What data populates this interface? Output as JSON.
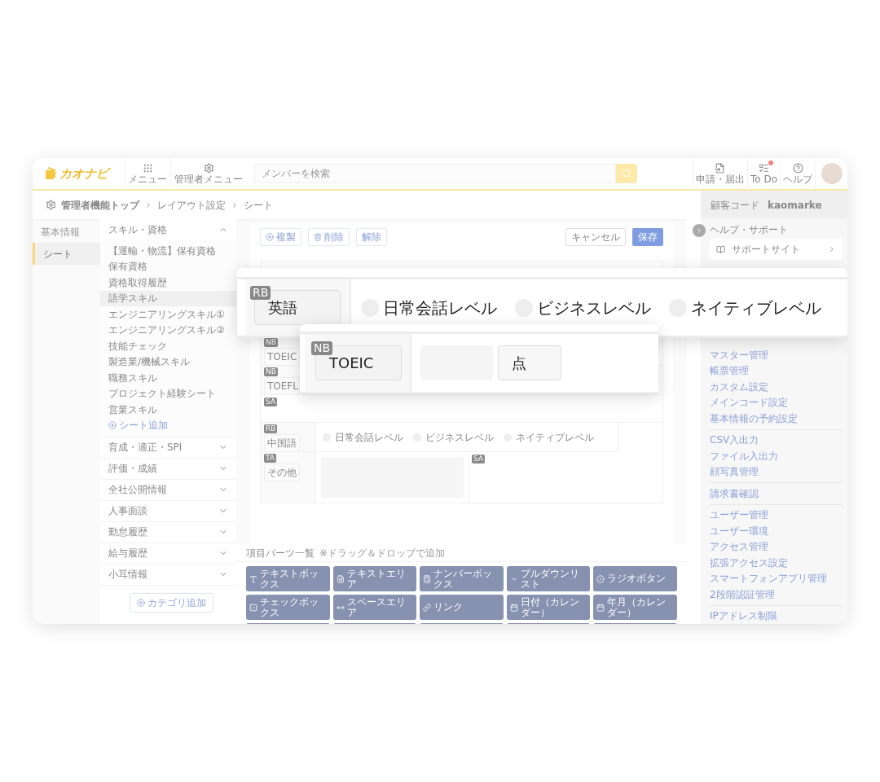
{
  "header": {
    "logo": "カオナビ",
    "nav_buttons": [
      {
        "kind": "menu",
        "label": "メニュー"
      },
      {
        "kind": "admin",
        "label": "管理者メニュー"
      }
    ],
    "search": {
      "placeholder": "メンバーを検索"
    },
    "actions": [
      {
        "kind": "request",
        "label": "申請・届出",
        "badge": false
      },
      {
        "kind": "todo",
        "label": "To Do",
        "badge": true
      },
      {
        "kind": "help",
        "label": "ヘルプ",
        "badge": false
      }
    ]
  },
  "breadcrumb": [
    "管理者機能トップ",
    "レイアウト設定",
    "シート"
  ],
  "customer_code": {
    "label": "顧客コード",
    "value": "kaomarke"
  },
  "main_nav": [
    {
      "label": "基本情報",
      "selected": false
    },
    {
      "label": "シート",
      "selected": true
    }
  ],
  "categories": [
    {
      "label": "スキル・資格",
      "expanded": true,
      "add_label": "シート追加",
      "sheets": [
        {
          "label": "【運輸・物流】保有資格",
          "selected": false
        },
        {
          "label": "保有資格",
          "selected": false
        },
        {
          "label": "資格取得履歴",
          "selected": false
        },
        {
          "label": "語学スキル",
          "selected": true
        },
        {
          "label": "エンジニアリングスキル①",
          "selected": false
        },
        {
          "label": "エンジニアリングスキル②",
          "selected": false
        },
        {
          "label": "技能チェック",
          "selected": false
        },
        {
          "label": "製造業/機械スキル",
          "selected": false
        },
        {
          "label": "職務スキル",
          "selected": false
        },
        {
          "label": "プロジェクト経験シート",
          "selected": false
        },
        {
          "label": "営業スキル",
          "selected": false
        }
      ]
    },
    {
      "label": "育成・適正・SPI",
      "expanded": false
    },
    {
      "label": "評価・成績",
      "expanded": false
    },
    {
      "label": "全社公開情報",
      "expanded": false
    },
    {
      "label": "人事面談",
      "expanded": false
    },
    {
      "label": "勤怠履歴",
      "expanded": false
    },
    {
      "label": "給与履歴",
      "expanded": false
    },
    {
      "label": "小耳情報",
      "expanded": false
    }
  ],
  "add_category": "カテゴリ追加",
  "toolbar": [
    {
      "kind": "copy",
      "label": "複製"
    },
    {
      "kind": "delete",
      "label": "削除"
    },
    {
      "kind": "plain",
      "label": "解除"
    },
    {
      "kind": "cancel",
      "label": "キャンセル"
    },
    {
      "kind": "save",
      "label": "保存"
    }
  ],
  "form_rows": [
    {
      "kind": "blank"
    },
    {
      "kind": "number",
      "tag": "NB",
      "label": "TOEIC"
    },
    {
      "kind": "number",
      "tag": "NB",
      "label": "TOEFL"
    },
    {
      "kind": "space",
      "tag": "SA"
    },
    {
      "kind": "radio",
      "tag": "RB",
      "label": "中国語",
      "options": [
        {
          "label": "日常会話レベル",
          "selected": false
        },
        {
          "label": "ビジネスレベル",
          "selected": false
        },
        {
          "label": "ネイティブレベル",
          "selected": false
        }
      ]
    },
    {
      "kind": "textarea",
      "tag": "TA",
      "label": "その他",
      "side_tag": "SA"
    }
  ],
  "parts_panel": {
    "title": "項目パーツ一覧",
    "hint": "※ドラッグ＆ドロップで追加",
    "parts": [
      {
        "kind": "textbox",
        "label": "テキストボックス"
      },
      {
        "kind": "textarea",
        "label": "テキストエリア"
      },
      {
        "kind": "number",
        "label": "ナンバーボックス"
      },
      {
        "kind": "pulldown",
        "label": "プルダウンリスト"
      },
      {
        "kind": "radio",
        "label": "ラジオボタン"
      },
      {
        "kind": "checkbox",
        "label": "チェックボックス"
      },
      {
        "kind": "space",
        "label": "スペースエリア"
      },
      {
        "kind": "link",
        "label": "リンク"
      },
      {
        "kind": "date",
        "label": "日付（カレンダー）"
      },
      {
        "kind": "month",
        "label": "年月（カレンダー）"
      }
    ]
  },
  "help_panel": {
    "title": "ヘルプ・サポート",
    "support_link": "サポートサイト",
    "link_groups": [
      [
        "マスター管理",
        "帳票管理",
        "カスタム設定",
        "メインコード設定",
        "基本情報の予約設定"
      ],
      [
        "CSV入出力",
        "ファイル入出力",
        "顔写真管理"
      ],
      [
        "請求書確認"
      ],
      [
        "ユーザー管理",
        "ユーザー環境",
        "アクセス管理",
        "拡張アクセス設定",
        "スマートフォンアプリ管理",
        "2段階認証管理"
      ],
      [
        "IPアドレス制限"
      ]
    ]
  },
  "zoom_cards": [
    {
      "kind": "radio",
      "tag": "RB",
      "label": "英語",
      "options": [
        {
          "label": "日常会話レベル",
          "selected": false
        },
        {
          "label": "ビジネスレベル",
          "selected": false
        },
        {
          "label": "ネイティブレベル",
          "selected": false
        }
      ]
    },
    {
      "kind": "number",
      "tag": "NB",
      "label": "TOEIC",
      "unit": "点"
    }
  ]
}
